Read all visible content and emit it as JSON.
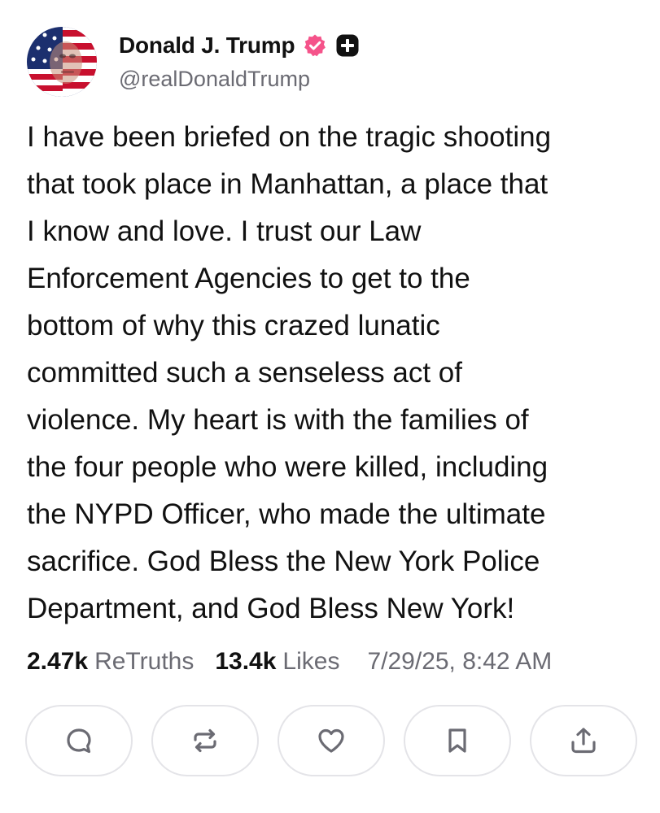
{
  "author": {
    "display_name": "Donald J. Trump",
    "handle": "@realDonaldTrump",
    "verified_icon": "verified-badge-icon",
    "plus_icon": "plus-badge-icon",
    "badge_color": "#f5538a"
  },
  "post": {
    "text": "I have been briefed on the tragic shooting\nthat took place in Manhattan, a place that\nI know and love. I trust our Law\nEnforcement Agencies to get to the\nbottom of why this crazed lunatic\ncommitted such a senseless act of\nviolence. My heart is with the families of\nthe four people who were killed, including\nthe NYPD Officer, who made the ultimate\nsacrifice. God Bless the New York Police\nDepartment, and God Bless New York!"
  },
  "stats": {
    "retruths_count": "2.47k",
    "retruths_label": "ReTruths",
    "likes_count": "13.4k",
    "likes_label": "Likes",
    "timestamp": "7/29/25, 8:42 AM"
  },
  "actions": [
    {
      "name": "reply",
      "icon": "comment-icon"
    },
    {
      "name": "retruth",
      "icon": "repost-icon"
    },
    {
      "name": "like",
      "icon": "heart-icon"
    },
    {
      "name": "bookmark",
      "icon": "bookmark-icon"
    },
    {
      "name": "share",
      "icon": "share-icon"
    }
  ],
  "colors": {
    "text": "#111111",
    "secondary_text": "#6b6b73",
    "button_border": "#e4e4e8",
    "icon": "#6b6b73"
  }
}
